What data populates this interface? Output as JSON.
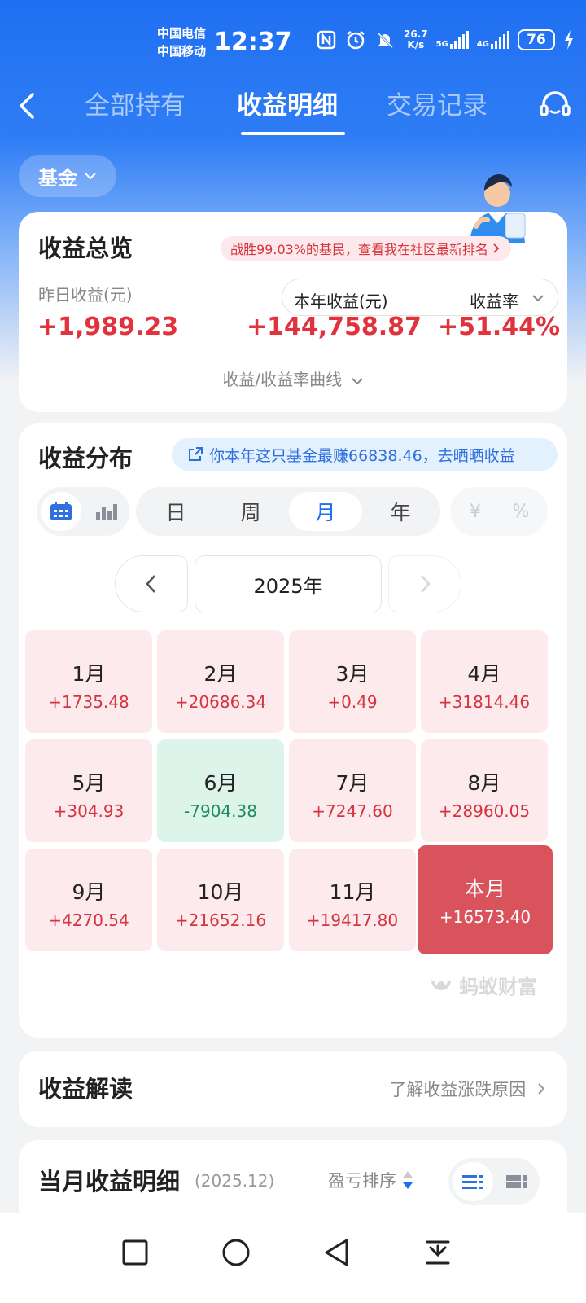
{
  "status": {
    "carrier1": "中国电信",
    "carrier2": "中国移动",
    "time": "12:37",
    "speed_value": "26.7",
    "speed_unit": "K/s",
    "net1": "5G",
    "net2": "4G",
    "battery": "76"
  },
  "nav": {
    "tabs": [
      "全部持有",
      "收益明细",
      "交易记录"
    ],
    "active_tab": "收益明细"
  },
  "filter": {
    "label": "基金"
  },
  "overview": {
    "title": "收益总览",
    "rank_text": "战胜99.03%的基民，查看我在社区最新排名",
    "yesterday_label": "昨日收益(元)",
    "yesterday_value": "+1,989.23",
    "year_label": "本年收益(元)",
    "rate_label": "收益率",
    "year_value": "+144,758.87",
    "rate_value": "+51.44%",
    "curve_link": "收益/收益率曲线"
  },
  "distribution": {
    "title": "收益分布",
    "share_text": "你本年这只基金最赚66838.46，去晒晒收益",
    "periods": [
      "日",
      "周",
      "月",
      "年"
    ],
    "selected_period": "月",
    "units": [
      "¥",
      "%"
    ],
    "year": "2025年",
    "months": [
      {
        "name": "1月",
        "value": "+1735.48",
        "state": "pos"
      },
      {
        "name": "2月",
        "value": "+20686.34",
        "state": "pos"
      },
      {
        "name": "3月",
        "value": "+0.49",
        "state": "pos"
      },
      {
        "name": "4月",
        "value": "+31814.46",
        "state": "pos"
      },
      {
        "name": "5月",
        "value": "+304.93",
        "state": "pos"
      },
      {
        "name": "6月",
        "value": "-7904.38",
        "state": "neg"
      },
      {
        "name": "7月",
        "value": "+7247.60",
        "state": "pos"
      },
      {
        "name": "8月",
        "value": "+28960.05",
        "state": "pos"
      },
      {
        "name": "9月",
        "value": "+4270.54",
        "state": "pos"
      },
      {
        "name": "10月",
        "value": "+21652.16",
        "state": "pos"
      },
      {
        "name": "11月",
        "value": "+19417.80",
        "state": "pos"
      },
      {
        "name": "本月",
        "value": "+16573.40",
        "state": "cur"
      }
    ],
    "watermark": "蚂蚁财富"
  },
  "interpretation": {
    "title": "收益解读",
    "link": "了解收益涨跌原因"
  },
  "monthly": {
    "title": "当月收益明细",
    "period": "(2025.12)",
    "sort_label": "盈亏排序"
  },
  "colors": {
    "brand_blue": "#1f6ff2",
    "gain_red": "#e0333e",
    "loss_green": "#1f8a5c",
    "current_month": "#d9535d"
  }
}
